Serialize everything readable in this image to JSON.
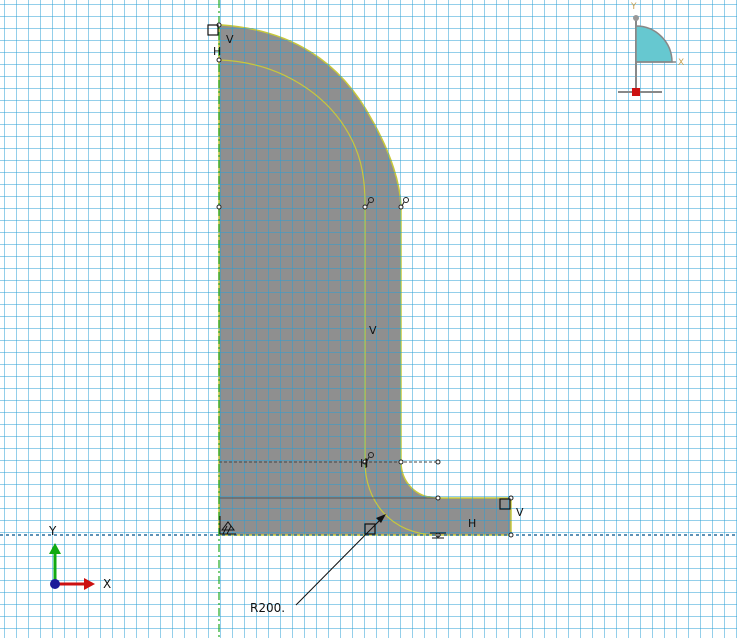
{
  "viewport": {
    "grid_color": "#2a9fd6",
    "background": "#ffffff",
    "part_fill": "#8f8f8f",
    "edge_color": "#c8c83c",
    "symmetry_line_color": "#22aa22"
  },
  "constraints": {
    "v_top_left": "V",
    "h_top_left": "H",
    "v_middle": "V",
    "h_lower": "H",
    "h_bottom": "H",
    "v_bottom_right": "V"
  },
  "dimension": {
    "label": "R200."
  },
  "triad": {
    "x_label": "X",
    "y_label": "Y",
    "x_color": "#cc1111",
    "y_color": "#11aa11",
    "origin_color": "#1a1a99"
  },
  "view_cube": {
    "x_label": "X",
    "y_label": "Y",
    "fill_color": "#66c8d0",
    "marker_color": "#cc1111"
  }
}
